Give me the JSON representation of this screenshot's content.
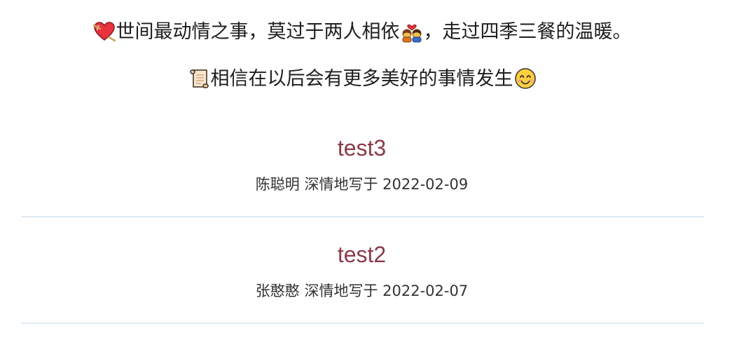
{
  "intro": {
    "line1_part1": "世间最动情之事，莫过于两人相依",
    "line1_part2": "，走过四季三餐的温暖。",
    "line2": "相信在以后会有更多美好的事情发生"
  },
  "icons": {
    "heart": "heart-icon",
    "couple": "couple-icon",
    "scroll": "scroll-icon",
    "smile": "smiling-face-icon"
  },
  "colors": {
    "title": "#8b3a48",
    "divider": "#dfeaf3",
    "text": "#333333"
  },
  "posts": [
    {
      "title": "test3",
      "author": "陈聪明",
      "verb": "深情地写于",
      "date": "2022-02-09"
    },
    {
      "title": "test2",
      "author": "张憨憨",
      "verb": "深情地写于",
      "date": "2022-02-07"
    }
  ]
}
